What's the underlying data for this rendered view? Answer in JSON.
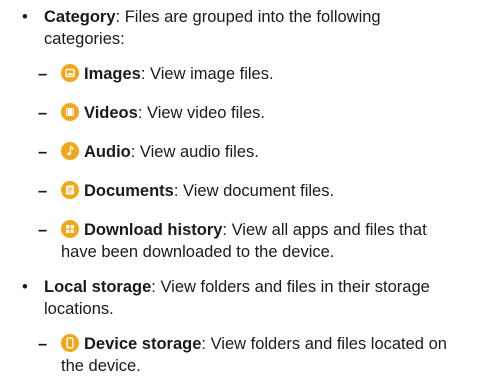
{
  "bullet_glyph": "•",
  "dash_glyph": "–",
  "accent_color": "#f2a71b",
  "items": [
    {
      "term": "Category",
      "desc": ": Files are grouped into the following categories:",
      "subitems": [
        {
          "icon": "image-icon",
          "term": "Images",
          "desc": ": View image files."
        },
        {
          "icon": "video-icon",
          "term": "Videos",
          "desc": ": View video files."
        },
        {
          "icon": "audio-icon",
          "term": "Audio",
          "desc": ": View audio files."
        },
        {
          "icon": "document-icon",
          "term": "Documents",
          "desc": ": View document files."
        },
        {
          "icon": "download-history-icon",
          "term": "Download history",
          "desc": ": View all apps and files that have been downloaded to the device."
        }
      ]
    },
    {
      "term": "Local storage",
      "desc": ": View folders and files in their storage locations.",
      "subitems": [
        {
          "icon": "device-storage-icon",
          "term": "Device storage",
          "desc": ": View folders and files located on the device."
        }
      ]
    }
  ]
}
